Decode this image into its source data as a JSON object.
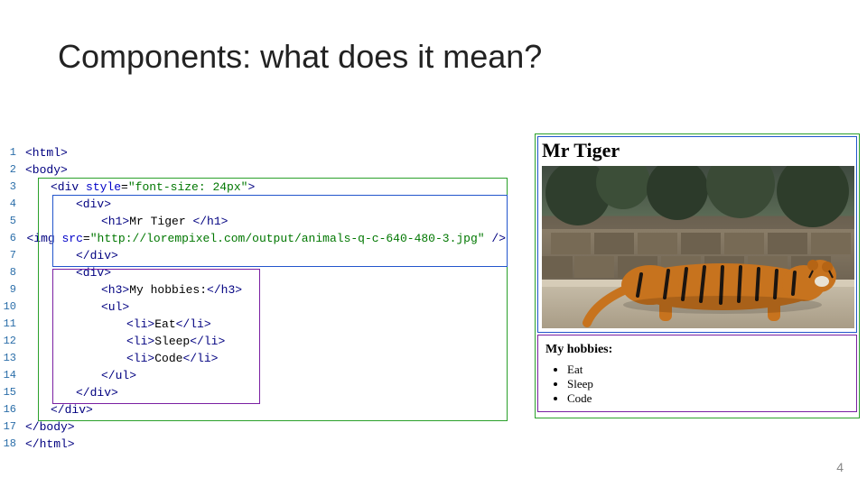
{
  "slide": {
    "title": "Components: what does it mean?",
    "page_number": "4"
  },
  "code": {
    "line_numbers": [
      "1",
      "2",
      "3",
      "4",
      "5",
      "6",
      "7",
      "8",
      "9",
      "10",
      "11",
      "12",
      "13",
      "14",
      "15",
      "16",
      "17",
      "18"
    ],
    "lines": [
      {
        "indent": 0,
        "segments": [
          {
            "t": "<html>",
            "c": "tag"
          }
        ]
      },
      {
        "indent": 0,
        "segments": [
          {
            "t": "<body>",
            "c": "tag"
          }
        ]
      },
      {
        "indent": 2,
        "segments": [
          {
            "t": "<div ",
            "c": "tag"
          },
          {
            "t": "style",
            "c": "attr"
          },
          {
            "t": "=",
            "c": "plain"
          },
          {
            "t": "\"font-size: 24px\"",
            "c": "str"
          },
          {
            "t": ">",
            "c": "tag"
          }
        ]
      },
      {
        "indent": 4,
        "segments": [
          {
            "t": "<div>",
            "c": "tag"
          }
        ]
      },
      {
        "indent": 6,
        "segments": [
          {
            "t": "<h1>",
            "c": "tag"
          },
          {
            "t": "Mr Tiger ",
            "c": "plain"
          },
          {
            "t": "</h1>",
            "c": "tag"
          }
        ]
      },
      {
        "indent": 6,
        "segments": [
          {
            "t": "<img ",
            "c": "tag"
          },
          {
            "t": "src",
            "c": "attr"
          },
          {
            "t": "=",
            "c": "plain"
          },
          {
            "t": "\"http://lorempixel.com/output/animals-q-c-640-480-3.jpg\"",
            "c": "str"
          },
          {
            "t": " />",
            "c": "tag"
          }
        ]
      },
      {
        "indent": 4,
        "segments": [
          {
            "t": "</div>",
            "c": "tag"
          }
        ]
      },
      {
        "indent": 4,
        "segments": [
          {
            "t": "<div>",
            "c": "tag"
          }
        ]
      },
      {
        "indent": 6,
        "segments": [
          {
            "t": "<h3>",
            "c": "tag"
          },
          {
            "t": "My hobbies:",
            "c": "plain"
          },
          {
            "t": "</h3>",
            "c": "tag"
          }
        ]
      },
      {
        "indent": 6,
        "segments": [
          {
            "t": "<ul>",
            "c": "tag"
          }
        ]
      },
      {
        "indent": 8,
        "segments": [
          {
            "t": "<li>",
            "c": "tag"
          },
          {
            "t": "Eat",
            "c": "plain"
          },
          {
            "t": "</li>",
            "c": "tag"
          }
        ]
      },
      {
        "indent": 8,
        "segments": [
          {
            "t": "<li>",
            "c": "tag"
          },
          {
            "t": "Sleep",
            "c": "plain"
          },
          {
            "t": "</li>",
            "c": "tag"
          }
        ]
      },
      {
        "indent": 8,
        "segments": [
          {
            "t": "<li>",
            "c": "tag"
          },
          {
            "t": "Code",
            "c": "plain"
          },
          {
            "t": "</li>",
            "c": "tag"
          }
        ]
      },
      {
        "indent": 6,
        "segments": [
          {
            "t": "</ul>",
            "c": "tag"
          }
        ]
      },
      {
        "indent": 4,
        "segments": [
          {
            "t": "</div>",
            "c": "tag"
          }
        ]
      },
      {
        "indent": 2,
        "segments": [
          {
            "t": "</div>",
            "c": "tag"
          }
        ]
      },
      {
        "indent": 0,
        "segments": [
          {
            "t": "</body>",
            "c": "tag"
          }
        ]
      },
      {
        "indent": 0,
        "segments": [
          {
            "t": "</html>",
            "c": "tag"
          }
        ]
      }
    ]
  },
  "render": {
    "heading": "Mr Tiger",
    "hobbies_heading": "My hobbies:",
    "hobbies": [
      "Eat",
      "Sleep",
      "Code"
    ]
  }
}
